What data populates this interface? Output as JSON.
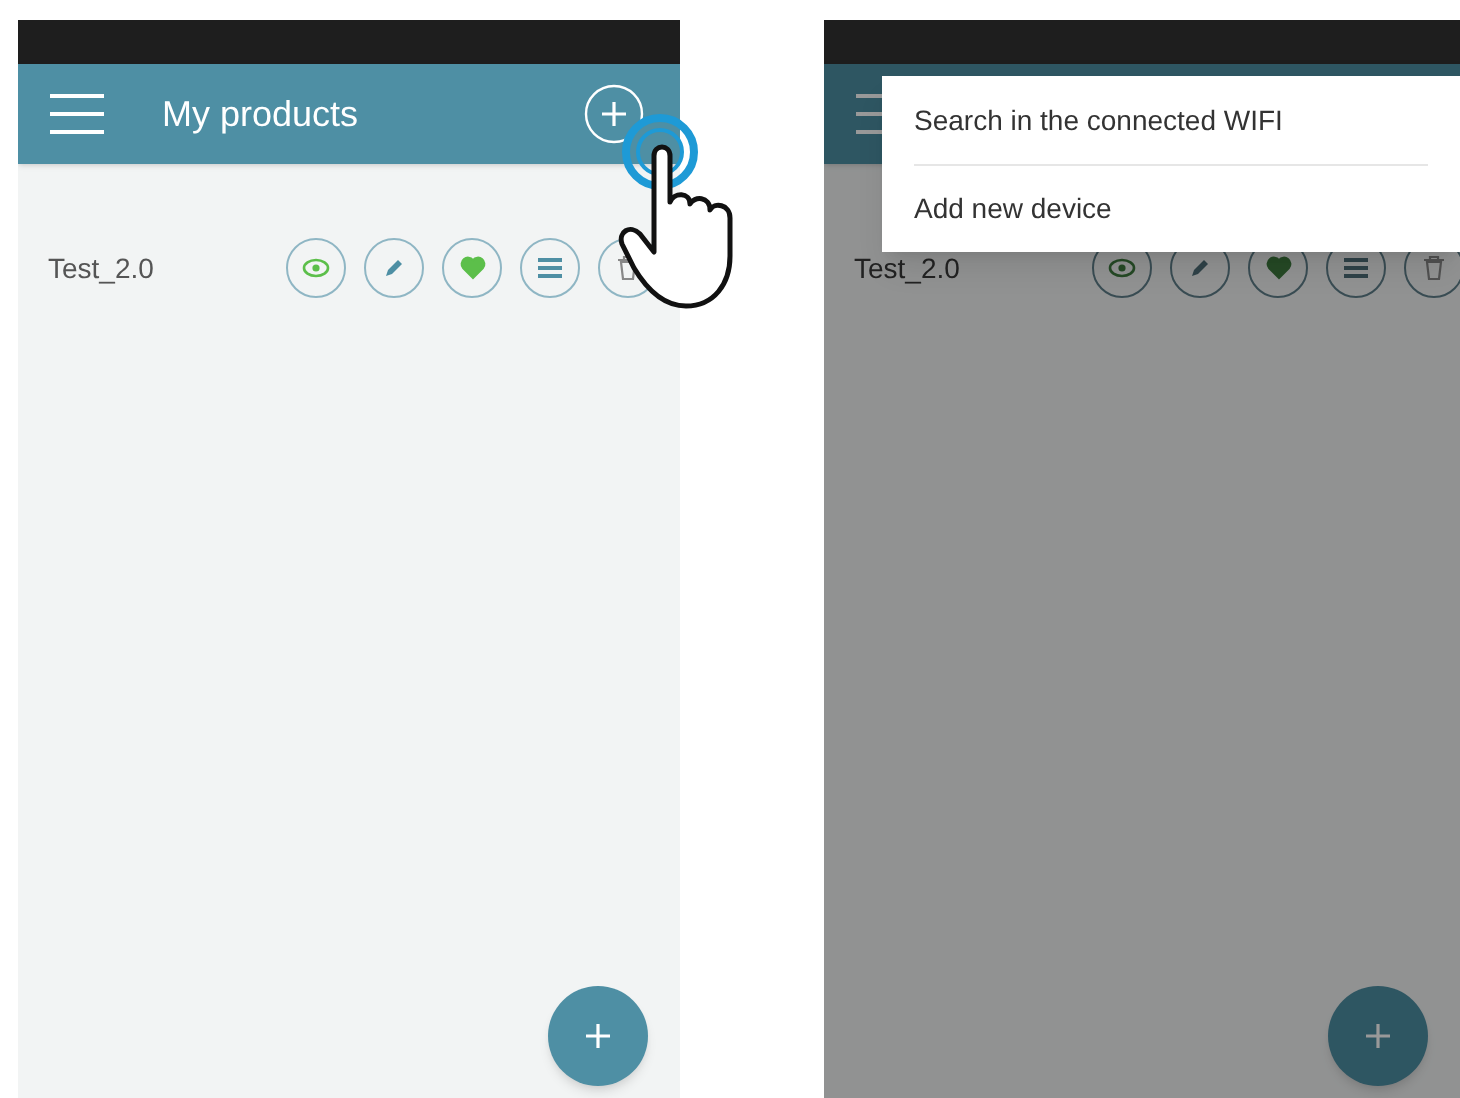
{
  "screens": [
    {
      "title": "My products",
      "menu_open": false,
      "tap_hint": true,
      "products": [
        {
          "name": "Test_2.0",
          "favorite": true
        }
      ]
    },
    {
      "menu_open": true,
      "products": [
        {
          "name": "Test_2.0",
          "favorite": true
        }
      ],
      "menu": [
        {
          "label": "Search in the connected WIFI"
        },
        {
          "label": "Add new device"
        }
      ]
    }
  ]
}
